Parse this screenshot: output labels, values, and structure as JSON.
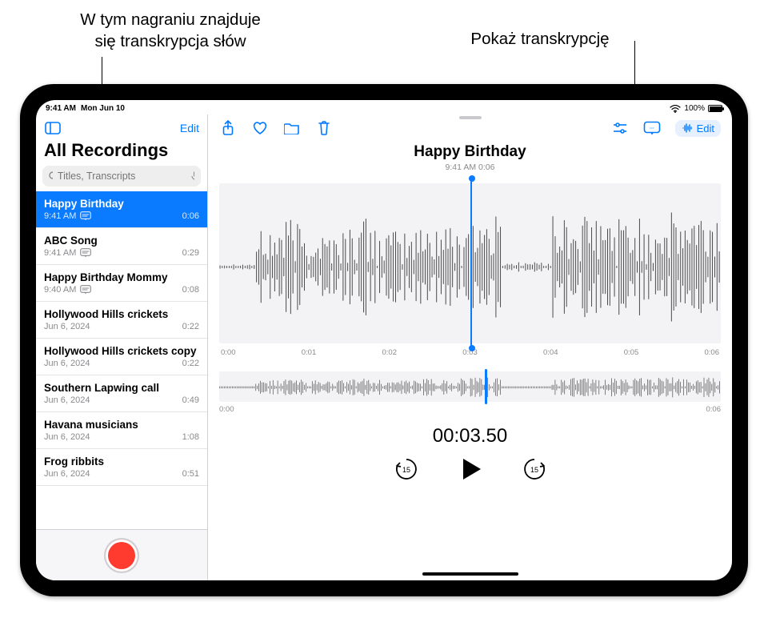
{
  "callouts": {
    "left": "W tym nagraniu znajduje\nsię transkrypcja słów",
    "right": "Pokaż transkrypcję"
  },
  "statusbar": {
    "time": "9:41 AM",
    "date": "Mon Jun 10",
    "battery": "100%"
  },
  "sidebar": {
    "edit": "Edit",
    "title": "All Recordings",
    "search_placeholder": "Titles, Transcripts",
    "items": [
      {
        "title": "Happy Birthday",
        "subtitle": "9:41 AM",
        "has_transcript": true,
        "duration": "0:06",
        "selected": true
      },
      {
        "title": "ABC Song",
        "subtitle": "9:41 AM",
        "has_transcript": true,
        "duration": "0:29",
        "selected": false
      },
      {
        "title": "Happy Birthday Mommy",
        "subtitle": "9:40 AM",
        "has_transcript": true,
        "duration": "0:08",
        "selected": false
      },
      {
        "title": "Hollywood Hills crickets",
        "subtitle": "Jun 6, 2024",
        "has_transcript": false,
        "duration": "0:22",
        "selected": false
      },
      {
        "title": "Hollywood Hills crickets copy",
        "subtitle": "Jun 6, 2024",
        "has_transcript": false,
        "duration": "0:22",
        "selected": false
      },
      {
        "title": "Southern Lapwing call",
        "subtitle": "Jun 6, 2024",
        "has_transcript": false,
        "duration": "0:49",
        "selected": false
      },
      {
        "title": "Havana musicians",
        "subtitle": "Jun 6, 2024",
        "has_transcript": false,
        "duration": "1:08",
        "selected": false
      },
      {
        "title": "Frog ribbits",
        "subtitle": "Jun 6, 2024",
        "has_transcript": false,
        "duration": "0:51",
        "selected": false
      }
    ]
  },
  "detail": {
    "title": "Happy Birthday",
    "subtitle": "9:41 AM   0:06",
    "ruler": [
      "0:00",
      "0:01",
      "0:02",
      "0:03",
      "0:04",
      "0:05",
      "0:06"
    ],
    "overview_ruler_start": "0:00",
    "overview_ruler_end": "0:06",
    "timer": "00:03.50",
    "edit_label": "Edit",
    "skip_seconds": "15"
  },
  "icons": {
    "panel": "panel",
    "share": "share",
    "heart": "heart",
    "folder": "folder",
    "trash": "trash",
    "sliders": "sliders",
    "transcript": "transcript",
    "wave": "wave"
  }
}
